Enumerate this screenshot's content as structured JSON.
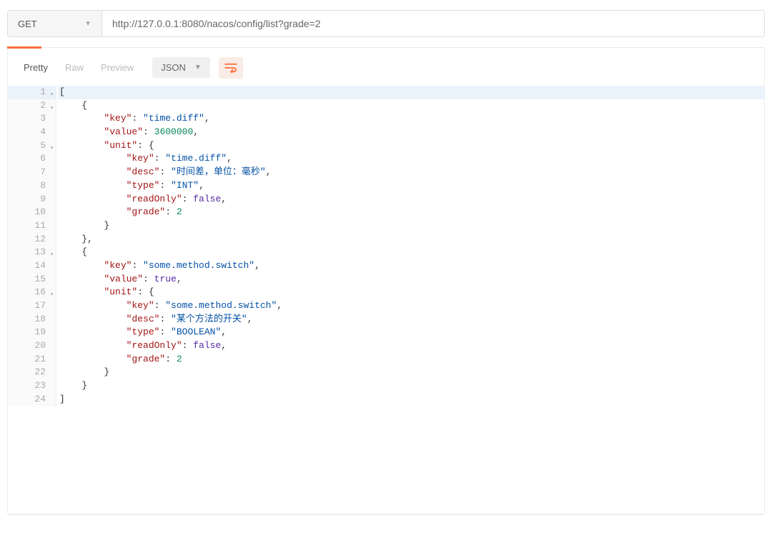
{
  "request": {
    "method": "GET",
    "url": "http://127.0.0.1:8080/nacos/config/list?grade=2"
  },
  "toolbar": {
    "tabs": [
      "Pretty",
      "Raw",
      "Preview"
    ],
    "active_tab": "Pretty",
    "format": "JSON"
  },
  "code": {
    "lines": [
      {
        "n": 1,
        "fold": true,
        "hl": true,
        "indent": 0,
        "tokens": [
          [
            "punct",
            "["
          ]
        ]
      },
      {
        "n": 2,
        "fold": true,
        "hl": false,
        "indent": 1,
        "tokens": [
          [
            "punct",
            "{"
          ]
        ]
      },
      {
        "n": 3,
        "fold": false,
        "hl": false,
        "indent": 2,
        "tokens": [
          [
            "key",
            "\"key\""
          ],
          [
            "punct",
            ": "
          ],
          [
            "str",
            "\"time.diff\""
          ],
          [
            "punct",
            ","
          ]
        ]
      },
      {
        "n": 4,
        "fold": false,
        "hl": false,
        "indent": 2,
        "tokens": [
          [
            "key",
            "\"value\""
          ],
          [
            "punct",
            ": "
          ],
          [
            "num",
            "3600000"
          ],
          [
            "punct",
            ","
          ]
        ]
      },
      {
        "n": 5,
        "fold": true,
        "hl": false,
        "indent": 2,
        "tokens": [
          [
            "key",
            "\"unit\""
          ],
          [
            "punct",
            ": {"
          ]
        ]
      },
      {
        "n": 6,
        "fold": false,
        "hl": false,
        "indent": 3,
        "tokens": [
          [
            "key",
            "\"key\""
          ],
          [
            "punct",
            ": "
          ],
          [
            "str",
            "\"time.diff\""
          ],
          [
            "punct",
            ","
          ]
        ]
      },
      {
        "n": 7,
        "fold": false,
        "hl": false,
        "indent": 3,
        "tokens": [
          [
            "key",
            "\"desc\""
          ],
          [
            "punct",
            ": "
          ],
          [
            "str",
            "\"时间差，单位：毫秒\""
          ],
          [
            "punct",
            ","
          ]
        ]
      },
      {
        "n": 8,
        "fold": false,
        "hl": false,
        "indent": 3,
        "tokens": [
          [
            "key",
            "\"type\""
          ],
          [
            "punct",
            ": "
          ],
          [
            "str",
            "\"INT\""
          ],
          [
            "punct",
            ","
          ]
        ]
      },
      {
        "n": 9,
        "fold": false,
        "hl": false,
        "indent": 3,
        "tokens": [
          [
            "key",
            "\"readOnly\""
          ],
          [
            "punct",
            ": "
          ],
          [
            "bool",
            "false"
          ],
          [
            "punct",
            ","
          ]
        ]
      },
      {
        "n": 10,
        "fold": false,
        "hl": false,
        "indent": 3,
        "tokens": [
          [
            "key",
            "\"grade\""
          ],
          [
            "punct",
            ": "
          ],
          [
            "num",
            "2"
          ]
        ]
      },
      {
        "n": 11,
        "fold": false,
        "hl": false,
        "indent": 2,
        "tokens": [
          [
            "punct",
            "}"
          ]
        ]
      },
      {
        "n": 12,
        "fold": false,
        "hl": false,
        "indent": 1,
        "tokens": [
          [
            "punct",
            "},"
          ]
        ]
      },
      {
        "n": 13,
        "fold": true,
        "hl": false,
        "indent": 1,
        "tokens": [
          [
            "punct",
            "{"
          ]
        ]
      },
      {
        "n": 14,
        "fold": false,
        "hl": false,
        "indent": 2,
        "tokens": [
          [
            "key",
            "\"key\""
          ],
          [
            "punct",
            ": "
          ],
          [
            "str",
            "\"some.method.switch\""
          ],
          [
            "punct",
            ","
          ]
        ]
      },
      {
        "n": 15,
        "fold": false,
        "hl": false,
        "indent": 2,
        "tokens": [
          [
            "key",
            "\"value\""
          ],
          [
            "punct",
            ": "
          ],
          [
            "bool",
            "true"
          ],
          [
            "punct",
            ","
          ]
        ]
      },
      {
        "n": 16,
        "fold": true,
        "hl": false,
        "indent": 2,
        "tokens": [
          [
            "key",
            "\"unit\""
          ],
          [
            "punct",
            ": {"
          ]
        ]
      },
      {
        "n": 17,
        "fold": false,
        "hl": false,
        "indent": 3,
        "tokens": [
          [
            "key",
            "\"key\""
          ],
          [
            "punct",
            ": "
          ],
          [
            "str",
            "\"some.method.switch\""
          ],
          [
            "punct",
            ","
          ]
        ]
      },
      {
        "n": 18,
        "fold": false,
        "hl": false,
        "indent": 3,
        "tokens": [
          [
            "key",
            "\"desc\""
          ],
          [
            "punct",
            ": "
          ],
          [
            "str",
            "\"某个方法的开关\""
          ],
          [
            "punct",
            ","
          ]
        ]
      },
      {
        "n": 19,
        "fold": false,
        "hl": false,
        "indent": 3,
        "tokens": [
          [
            "key",
            "\"type\""
          ],
          [
            "punct",
            ": "
          ],
          [
            "str",
            "\"BOOLEAN\""
          ],
          [
            "punct",
            ","
          ]
        ]
      },
      {
        "n": 20,
        "fold": false,
        "hl": false,
        "indent": 3,
        "tokens": [
          [
            "key",
            "\"readOnly\""
          ],
          [
            "punct",
            ": "
          ],
          [
            "bool",
            "false"
          ],
          [
            "punct",
            ","
          ]
        ]
      },
      {
        "n": 21,
        "fold": false,
        "hl": false,
        "indent": 3,
        "tokens": [
          [
            "key",
            "\"grade\""
          ],
          [
            "punct",
            ": "
          ],
          [
            "num",
            "2"
          ]
        ]
      },
      {
        "n": 22,
        "fold": false,
        "hl": false,
        "indent": 2,
        "tokens": [
          [
            "punct",
            "}"
          ]
        ]
      },
      {
        "n": 23,
        "fold": false,
        "hl": false,
        "indent": 1,
        "tokens": [
          [
            "punct",
            "}"
          ]
        ]
      },
      {
        "n": 24,
        "fold": false,
        "hl": false,
        "indent": 0,
        "tokens": [
          [
            "punct",
            "]"
          ]
        ]
      }
    ]
  }
}
